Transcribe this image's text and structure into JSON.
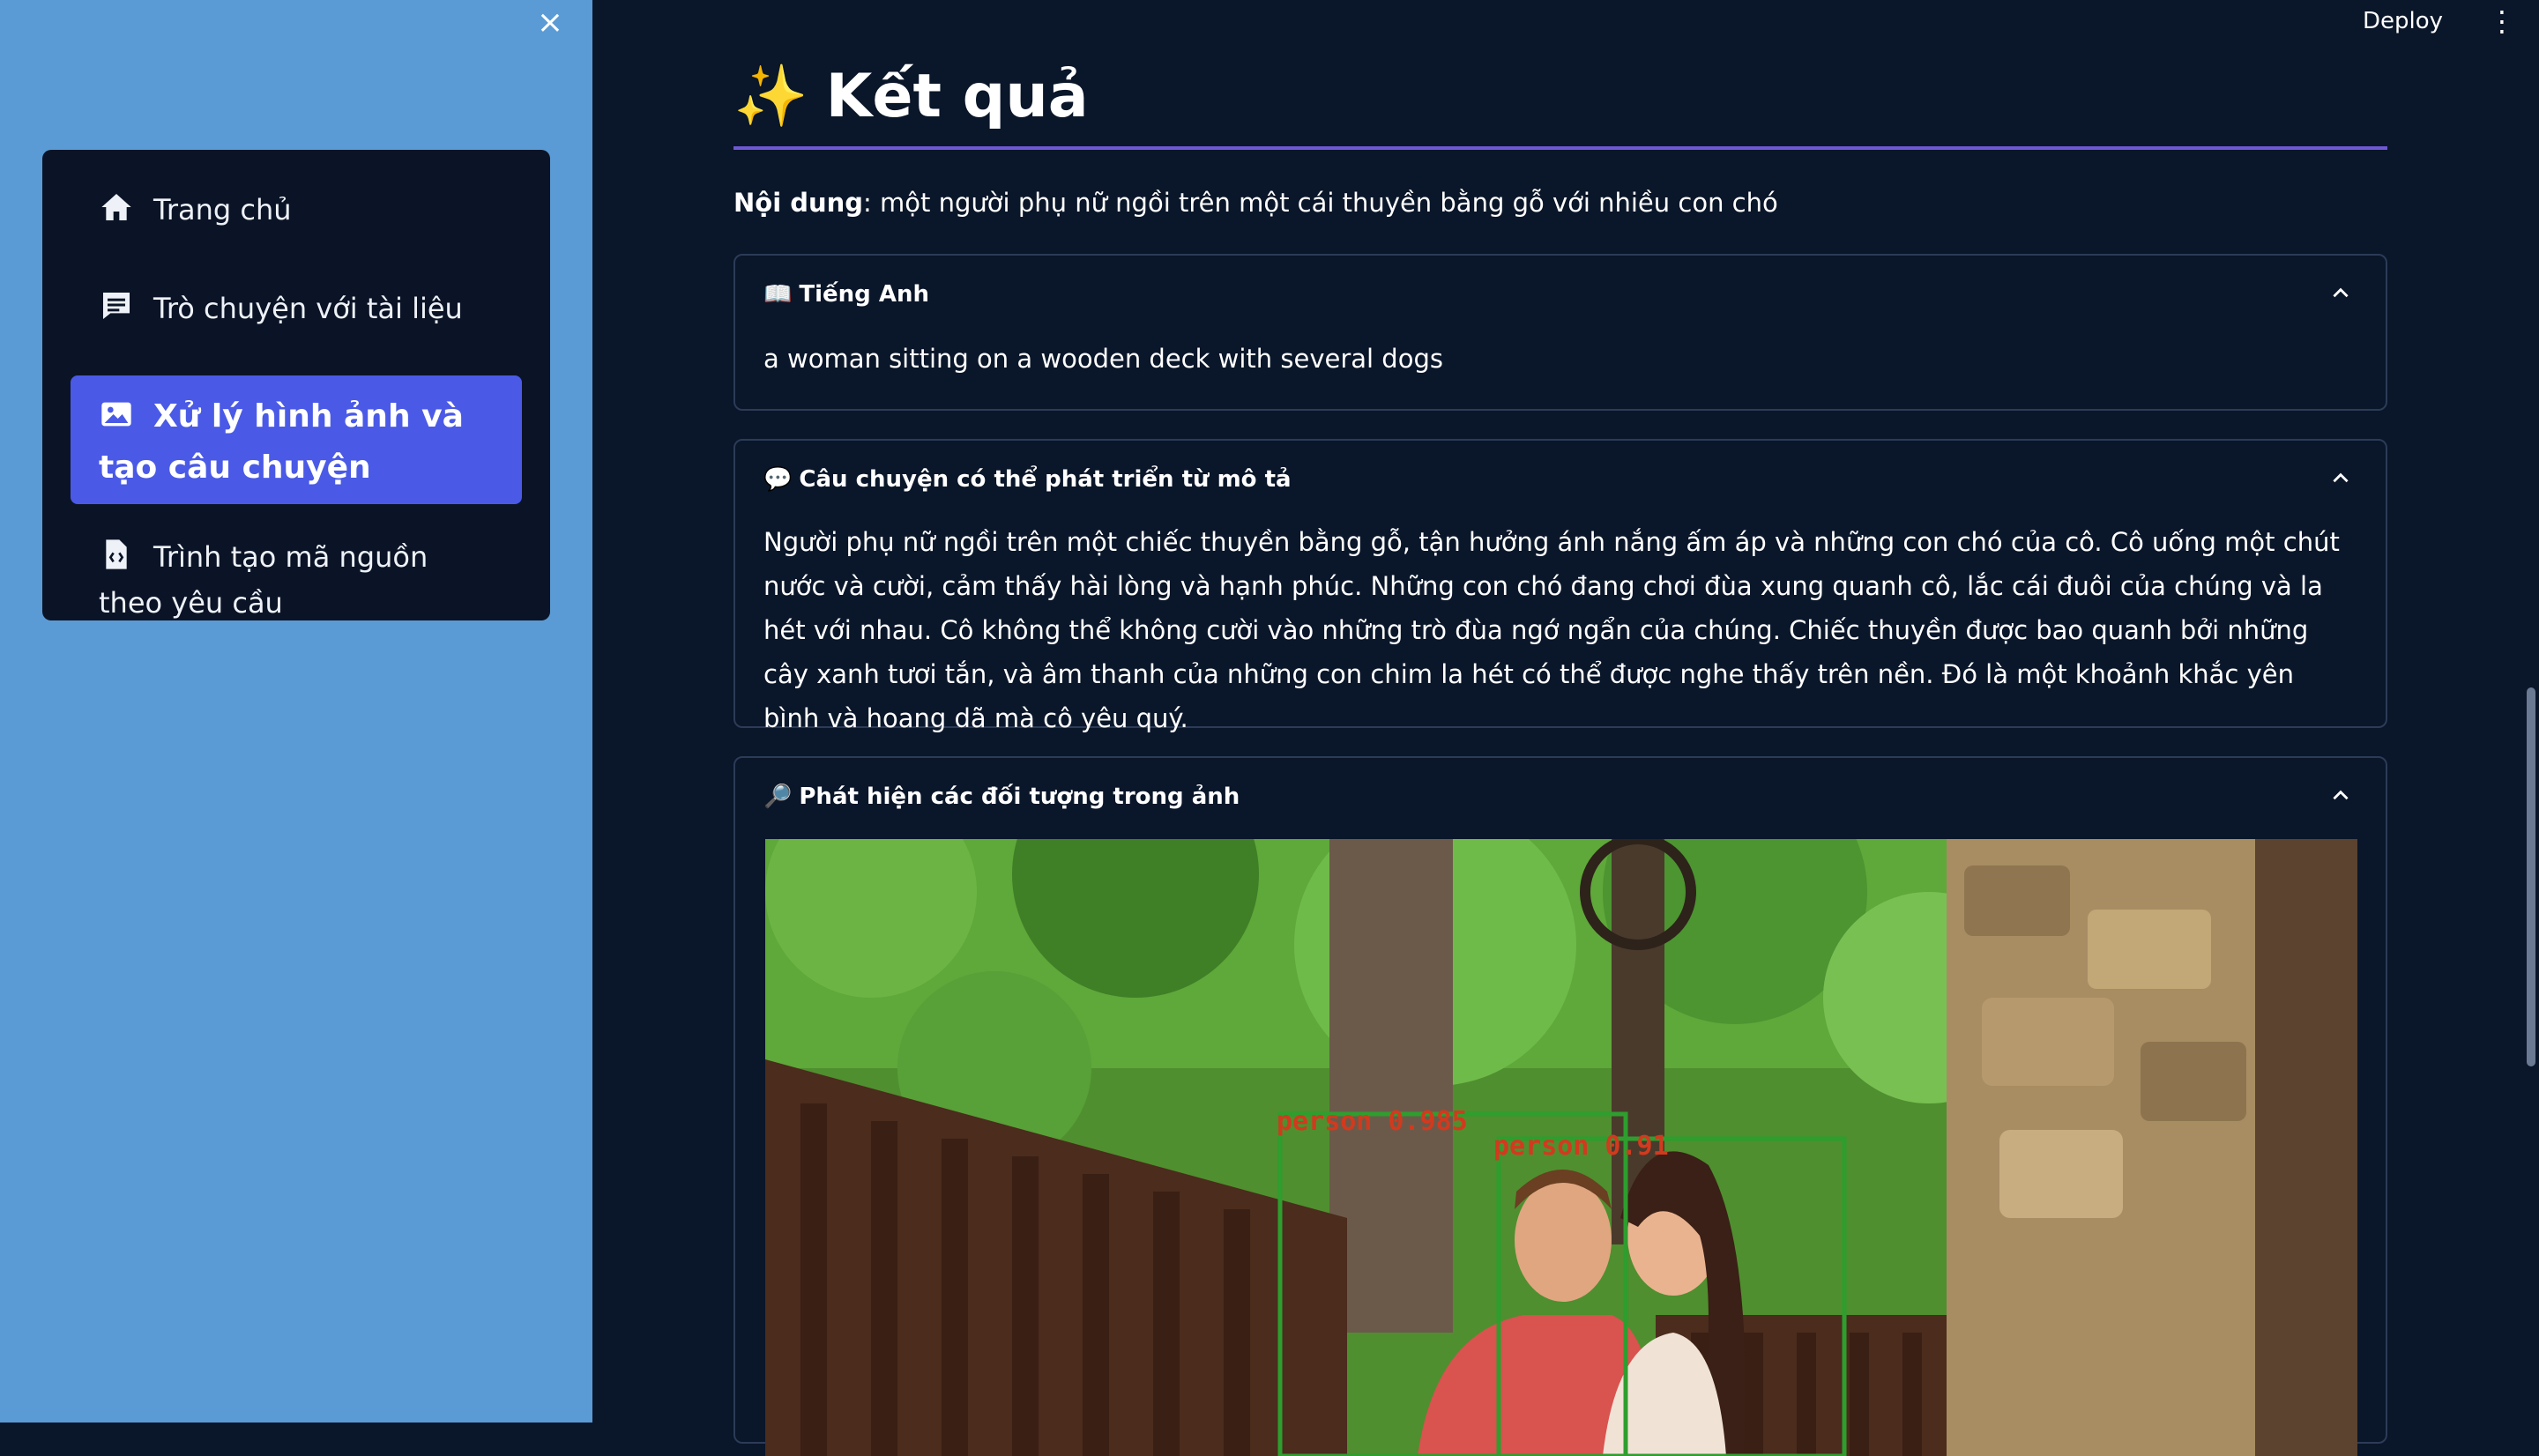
{
  "sidebar": {
    "close_label": "×",
    "items": [
      {
        "label": "Trang chủ",
        "icon": "home-icon"
      },
      {
        "label": "Trò chuyện với tài liệu",
        "icon": "chat-icon"
      },
      {
        "label": "Xử lý hình ảnh và tạo câu chuyện",
        "icon": "image-icon",
        "active": true
      },
      {
        "label": "Trình tạo mã nguồn theo yêu cầu",
        "icon": "code-file-icon"
      }
    ]
  },
  "header": {
    "deploy_label": "Deploy",
    "menu_label": "⋮"
  },
  "main": {
    "title_emoji": "✨",
    "title": "Kết quả",
    "content_label": "Nội dung",
    "content_sep": ":",
    "content_text": " một người phụ nữ ngồi trên một cái thuyền bằng gỗ với nhiều con chó",
    "expanders": [
      {
        "emoji": "📖",
        "title": "Tiếng Anh",
        "body": "a woman sitting on a wooden deck with several dogs"
      },
      {
        "emoji": "💬",
        "title": "Câu chuyện có thể phát triển từ mô tả",
        "body": "Người phụ nữ ngồi trên một chiếc thuyền bằng gỗ, tận hưởng ánh nắng ấm áp và những con chó của cô. Cô uống một chút nước và cười, cảm thấy hài lòng và hạnh phúc. Những con chó đang chơi đùa xung quanh cô, lắc cái đuôi của chúng và la hét với nhau. Cô không thể không cười vào những trò đùa ngớ ngẩn của chúng. Chiếc thuyền được bao quanh bởi những cây xanh tươi tắn, và âm thanh của những con chim la hét có thể được nghe thấy trên nền. Đó là một khoảnh khắc yên bình và hoang dã mà cô yêu quý."
      },
      {
        "emoji": "🔎",
        "title": "Phát hiện các đối tượng trong ảnh",
        "detections": [
          {
            "label": "person 0.985"
          },
          {
            "label": "person 0.91"
          }
        ]
      }
    ]
  },
  "colors": {
    "sidebar_bg": "#5b9bd5",
    "main_bg": "#0a1629",
    "active_nav": "#4a5ae6",
    "title_rule": "#6e58d6",
    "detection_box": "#2e9e2e",
    "detection_text": "#d23a1e"
  }
}
